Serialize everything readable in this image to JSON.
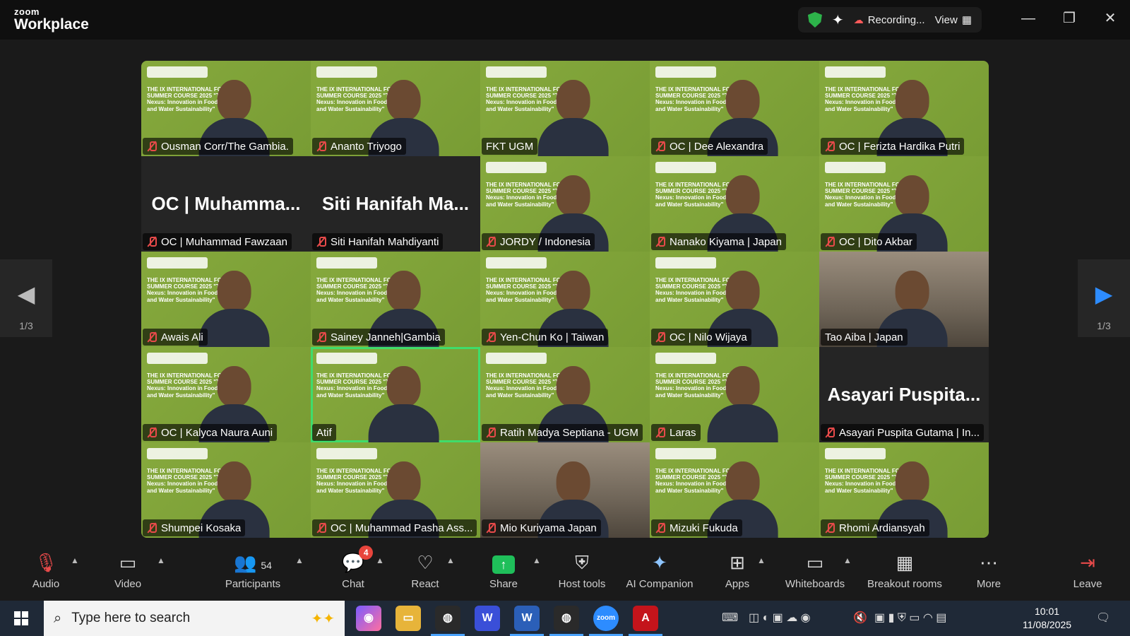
{
  "app": {
    "logo_line1": "zoom",
    "logo_line2": "Workplace",
    "recording_label": "Recording...",
    "view_label": "View"
  },
  "meeting_bg": {
    "title_text": "THE IX INTERNATIONAL FORESTRY SUMMER COURSE 2025 \"The Forest Nexus: Innovation in Food, Energy, and Water Sustainability\""
  },
  "pager": {
    "left_page": "1/3",
    "right_page": "1/3"
  },
  "participants": [
    {
      "name": "Ousman Corr/The Gambia.",
      "style": "green",
      "muted": true
    },
    {
      "name": "Ananto Triyogo",
      "style": "green",
      "muted": true
    },
    {
      "name": "FKT UGM",
      "style": "green",
      "muted": false
    },
    {
      "name": "OC | Dee Alexandra",
      "style": "green",
      "muted": true
    },
    {
      "name": "OC | Ferizta Hardika Putri",
      "style": "green",
      "muted": true
    },
    {
      "name": "OC | Muhammad Fawzaan",
      "style": "dark",
      "display": "OC | Muhamma...",
      "muted": true
    },
    {
      "name": "Siti Hanifah Mahdiyanti",
      "style": "dark",
      "display": "Siti Hanifah Ma...",
      "muted": true
    },
    {
      "name": "JORDY / Indonesia",
      "style": "green",
      "muted": true
    },
    {
      "name": "Nanako Kiyama | Japan",
      "style": "green",
      "muted": true
    },
    {
      "name": "OC | Dito Akbar",
      "style": "green",
      "muted": true
    },
    {
      "name": "Awais Ali",
      "style": "green",
      "muted": true
    },
    {
      "name": "Sainey Janneh|Gambia",
      "style": "green",
      "muted": true
    },
    {
      "name": "Yen-Chun Ko | Taiwan",
      "style": "green",
      "muted": true
    },
    {
      "name": "OC | Nilo Wijaya",
      "style": "green",
      "muted": true
    },
    {
      "name": "Tao Aiba | Japan",
      "style": "room",
      "muted": false
    },
    {
      "name": "OC | Kalyca Naura Auni",
      "style": "green",
      "muted": true
    },
    {
      "name": "Atif",
      "style": "green",
      "muted": false,
      "active": true
    },
    {
      "name": "Ratih Madya Septiana - UGM",
      "style": "green",
      "muted": true
    },
    {
      "name": "Laras",
      "style": "green",
      "muted": true
    },
    {
      "name": "Asayari Puspita Gutama | In...",
      "style": "dark",
      "display": "Asayari Puspita...",
      "muted": true
    },
    {
      "name": "Shumpei Kosaka",
      "style": "green",
      "muted": true
    },
    {
      "name": "OC | Muhammad Pasha Ass...",
      "style": "green",
      "muted": true
    },
    {
      "name": "Mio Kuriyama Japan",
      "style": "room",
      "muted": true
    },
    {
      "name": "Mizuki Fukuda",
      "style": "green",
      "muted": true
    },
    {
      "name": "Rhomi Ardiansyah",
      "style": "green",
      "muted": true
    }
  ],
  "toolbar": {
    "audio": "Audio",
    "video": "Video",
    "participants": "Participants",
    "participants_count": "54",
    "chat": "Chat",
    "chat_badge": "4",
    "react": "React",
    "share": "Share",
    "host_tools": "Host tools",
    "ai_companion": "AI Companion",
    "apps": "Apps",
    "whiteboards": "Whiteboards",
    "breakout_rooms": "Breakout rooms",
    "more": "More",
    "leave": "Leave"
  },
  "taskbar": {
    "search_placeholder": "Type here to search",
    "time": "10:01",
    "date": "11/08/2025"
  },
  "colors": {
    "tile_green": "#7ea33a",
    "active_speaker": "#3fdc6b",
    "muted_red": "#e84a4a",
    "share_green": "#1fbf5a",
    "badge_red": "#e8453c"
  }
}
